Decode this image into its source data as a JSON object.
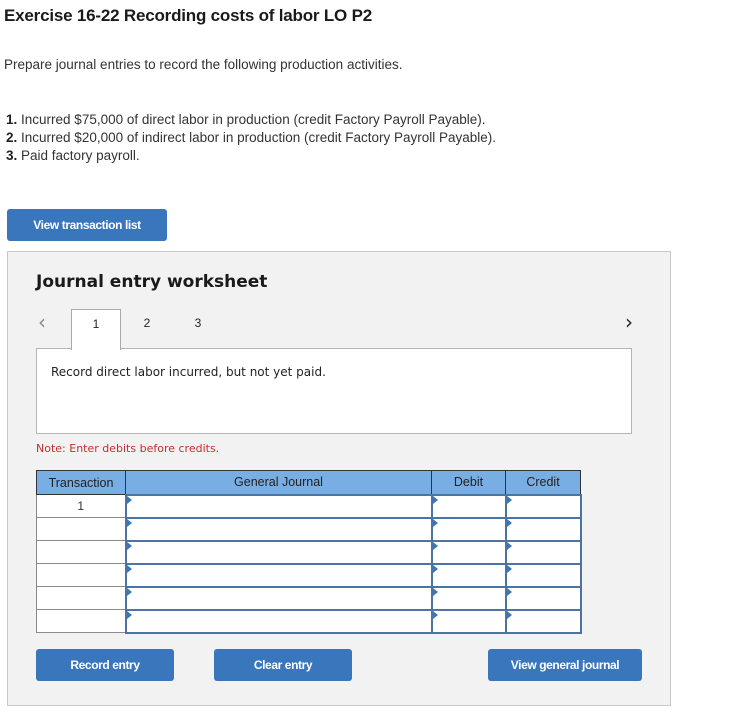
{
  "header": {
    "title": "Exercise 16-22 Recording costs of labor LO P2",
    "intro": "Prepare journal entries to record the following production activities."
  },
  "items": [
    {
      "num": "1.",
      "text": "Incurred $75,000 of direct labor in production (credit Factory Payroll Payable)."
    },
    {
      "num": "2.",
      "text": "Incurred $20,000 of indirect labor in production (credit Factory Payroll Payable)."
    },
    {
      "num": "3.",
      "text": "Paid factory payroll."
    }
  ],
  "buttons": {
    "view_transaction_list": "View transaction list",
    "record_entry": "Record entry",
    "clear_entry": "Clear entry",
    "view_general_journal": "View general journal"
  },
  "worksheet": {
    "title": "Journal entry worksheet",
    "prev_icon": "‹",
    "next_icon": "›",
    "tabs": [
      "1",
      "2",
      "3"
    ],
    "active_tab": "1",
    "instruction": "Record direct labor incurred, but not yet paid.",
    "note": "Note: Enter debits before credits."
  },
  "table": {
    "headers": [
      "Transaction",
      "General Journal",
      "Debit",
      "Credit"
    ],
    "rows": [
      {
        "transaction": "1",
        "account": "",
        "debit": "",
        "credit": ""
      },
      {
        "transaction": "",
        "account": "",
        "debit": "",
        "credit": ""
      },
      {
        "transaction": "",
        "account": "",
        "debit": "",
        "credit": ""
      },
      {
        "transaction": "",
        "account": "",
        "debit": "",
        "credit": ""
      },
      {
        "transaction": "",
        "account": "",
        "debit": "",
        "credit": ""
      },
      {
        "transaction": "",
        "account": "",
        "debit": "",
        "credit": ""
      }
    ]
  },
  "colors": {
    "button_bg": "#3a76bb",
    "table_header_bg": "#78aee3",
    "note_color": "#c0302b",
    "panel_bg": "#f2f2f2"
  }
}
